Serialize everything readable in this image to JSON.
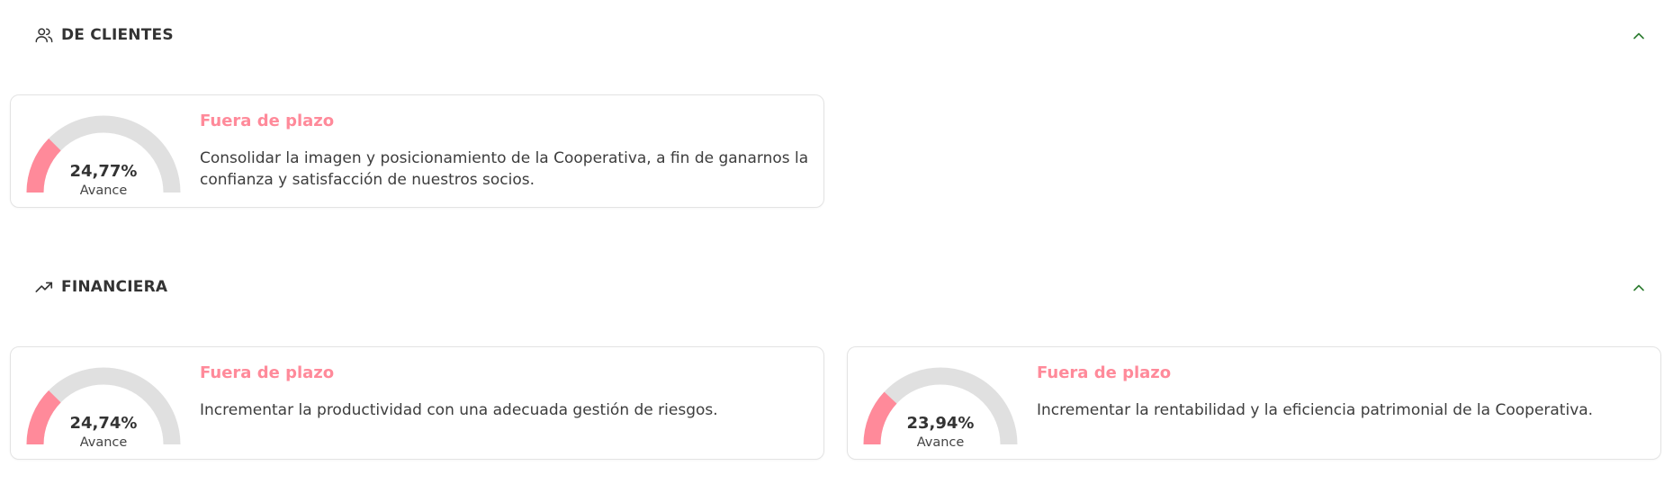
{
  "colors": {
    "accent_status": "#ff8a9a",
    "gauge_track": "#e0e0e0",
    "gauge_fill": "#ff8a9a",
    "chevron": "#2e7d32"
  },
  "sections": [
    {
      "title": "DE CLIENTES",
      "icon": "users-icon",
      "collapse_icon": "chevron-up-icon",
      "cards": [
        {
          "percent_label": "24,77%",
          "percent_value": 24.77,
          "progress_label": "Avance",
          "status": "Fuera de plazo",
          "description": "Consolidar la imagen y posicionamiento de la Cooperativa, a fin de ganarnos la confianza y satisfacción de nuestros socios."
        }
      ]
    },
    {
      "title": "FINANCIERA",
      "icon": "trending-up-icon",
      "collapse_icon": "chevron-up-icon",
      "cards": [
        {
          "percent_label": "24,74%",
          "percent_value": 24.74,
          "progress_label": "Avance",
          "status": "Fuera de plazo",
          "description": "Incrementar la productividad con una adecuada gestión de riesgos."
        },
        {
          "percent_label": "23,94%",
          "percent_value": 23.94,
          "progress_label": "Avance",
          "status": "Fuera de plazo",
          "description": "Incrementar la rentabilidad y la eficiencia patrimonial de la Cooperativa."
        }
      ]
    }
  ]
}
